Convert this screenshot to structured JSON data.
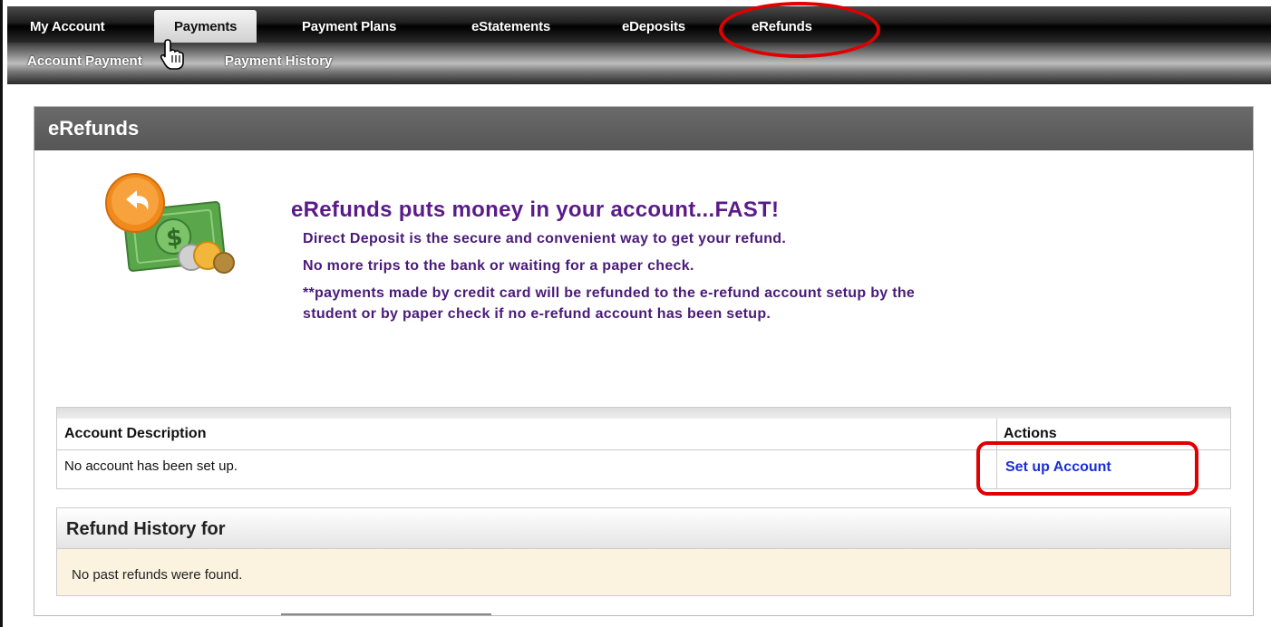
{
  "topnav": {
    "tabs": [
      {
        "label": "My Account"
      },
      {
        "label": "Payments"
      },
      {
        "label": "Payment Plans"
      },
      {
        "label": "eStatements"
      },
      {
        "label": "eDeposits"
      },
      {
        "label": "eRefunds"
      }
    ],
    "active_tab": "Payments"
  },
  "subnav": {
    "items": [
      {
        "label": "Account Payment"
      },
      {
        "label": "Payment History"
      }
    ]
  },
  "panel": {
    "title": "eRefunds",
    "promo_title": "eRefunds puts money in your account...FAST!",
    "promo_lines": [
      "Direct Deposit is the secure and convenient way to get your refund.",
      "No more trips to the bank or waiting for a paper check.",
      "**payments made by credit card will be refunded to the e-refund account setup by the",
      "student or by paper check if no e-refund account has been setup."
    ]
  },
  "account_table": {
    "headers": [
      "Account Description",
      "Actions"
    ],
    "row": {
      "description": "No account has been set up.",
      "action": "Set up Account"
    }
  },
  "refund_history": {
    "title": "Refund History for",
    "empty_message": "No past refunds were found."
  },
  "colors": {
    "highlight": "#e00000",
    "promo_text": "#5b1a8a",
    "link": "#1a2fd6"
  }
}
